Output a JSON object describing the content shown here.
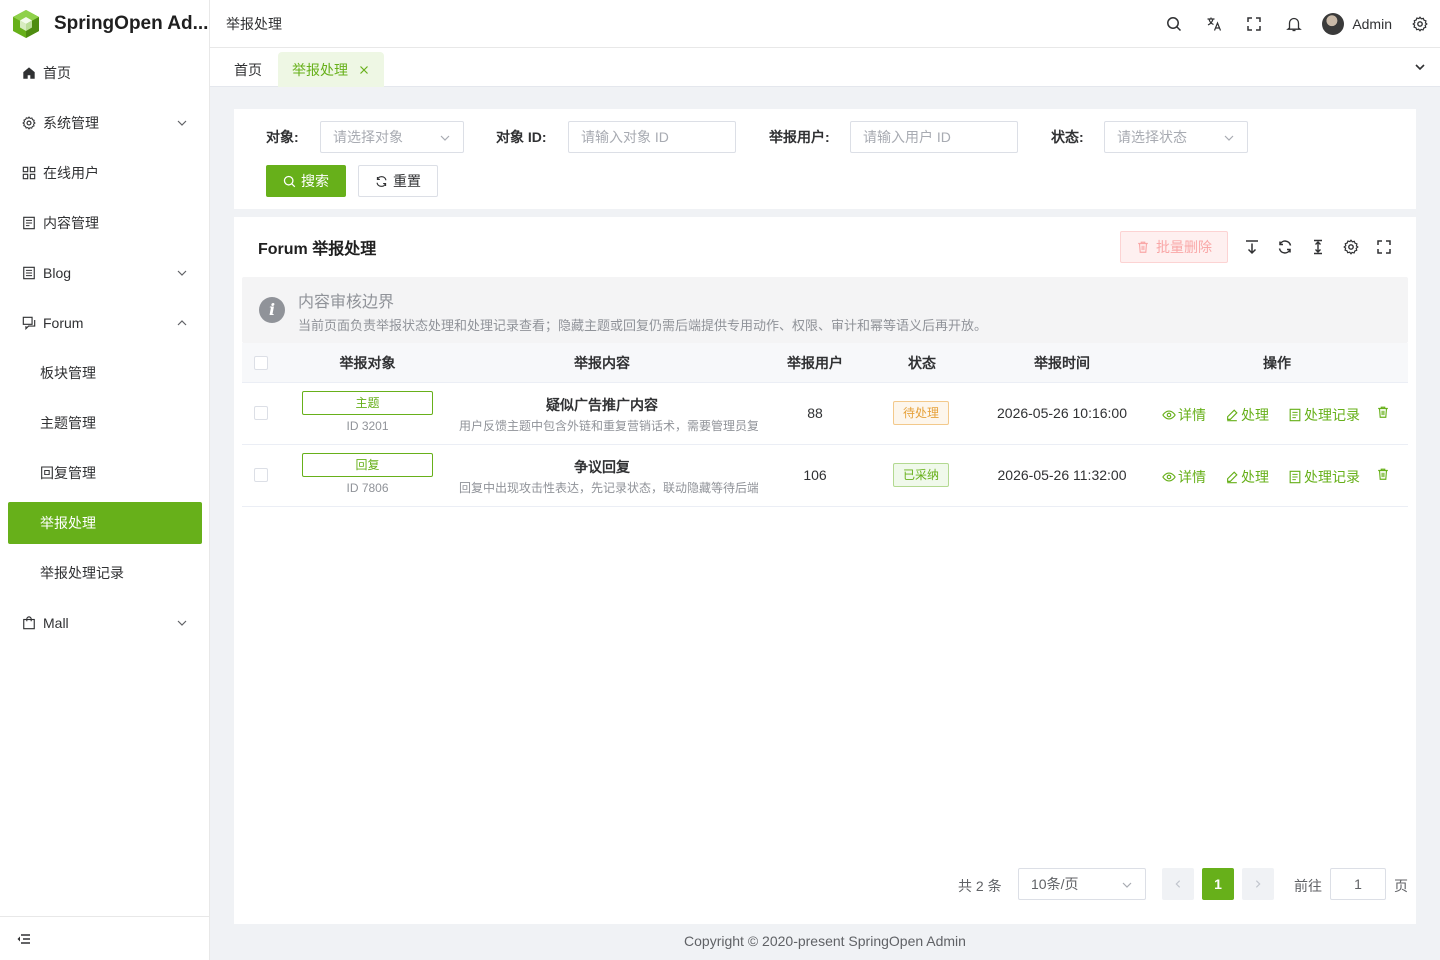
{
  "app": {
    "title": "SpringOpen Ad..."
  },
  "sidebar": {
    "items": [
      {
        "label": "首页"
      },
      {
        "label": "系统管理"
      },
      {
        "label": "在线用户"
      },
      {
        "label": "内容管理"
      },
      {
        "label": "Blog"
      },
      {
        "label": "Forum"
      },
      {
        "label": "板块管理"
      },
      {
        "label": "主题管理"
      },
      {
        "label": "回复管理"
      },
      {
        "label": "举报处理"
      },
      {
        "label": "举报处理记录"
      },
      {
        "label": "Mall"
      }
    ],
    "active_item": "举报处理"
  },
  "header": {
    "breadcrumb": "举报处理",
    "user_name": "Admin"
  },
  "tabs": [
    {
      "label": "首页"
    },
    {
      "label": "举报处理"
    }
  ],
  "search": {
    "object_label": "对象:",
    "object_placeholder": "请选择对象",
    "object_id_label": "对象 ID:",
    "object_id_placeholder": "请输入对象 ID",
    "user_label": "举报用户:",
    "user_placeholder": "请输入用户 ID",
    "status_label": "状态:",
    "status_placeholder": "请选择状态",
    "search_btn": "搜索",
    "reset_btn": "重置"
  },
  "card": {
    "title": "Forum 举报处理",
    "batch_delete": "批量删除"
  },
  "alert": {
    "title": "内容审核边界",
    "desc": "当前页面负责举报状态处理和处理记录查看；隐藏主题或回复仍需后端提供专用动作、权限、审计和幂等语义后再开放。"
  },
  "table": {
    "columns": [
      "举报对象",
      "举报内容",
      "举报用户",
      "状态",
      "举报时间",
      "操作"
    ],
    "rows": [
      {
        "type": "主题",
        "object_id": "ID 3201",
        "title": "疑似广告推广内容",
        "desc": "用户反馈主题中包含外链和重复营销话术，需要管理员复",
        "user": "88",
        "status": "待处理",
        "time": "2026-05-26 10:16:00"
      },
      {
        "type": "回复",
        "object_id": "ID 7806",
        "title": "争议回复",
        "desc": "回复中出现攻击性表达，先记录状态，联动隐藏等待后端",
        "user": "106",
        "status": "已采纳",
        "time": "2026-05-26 11:32:00"
      }
    ],
    "actions": {
      "detail": "详情",
      "process": "处理",
      "records": "处理记录"
    }
  },
  "pagination": {
    "total": "共 2 条",
    "page_size": "10条/页",
    "current": "1",
    "goto_label": "前往",
    "goto_value": "1",
    "page_suffix": "页"
  },
  "footer": {
    "copyright": "Copyright © 2020-present SpringOpen Admin"
  },
  "colors": {
    "primary": "#67b01a",
    "warning": "#e6a23c",
    "danger_light": "#fef0f0"
  }
}
